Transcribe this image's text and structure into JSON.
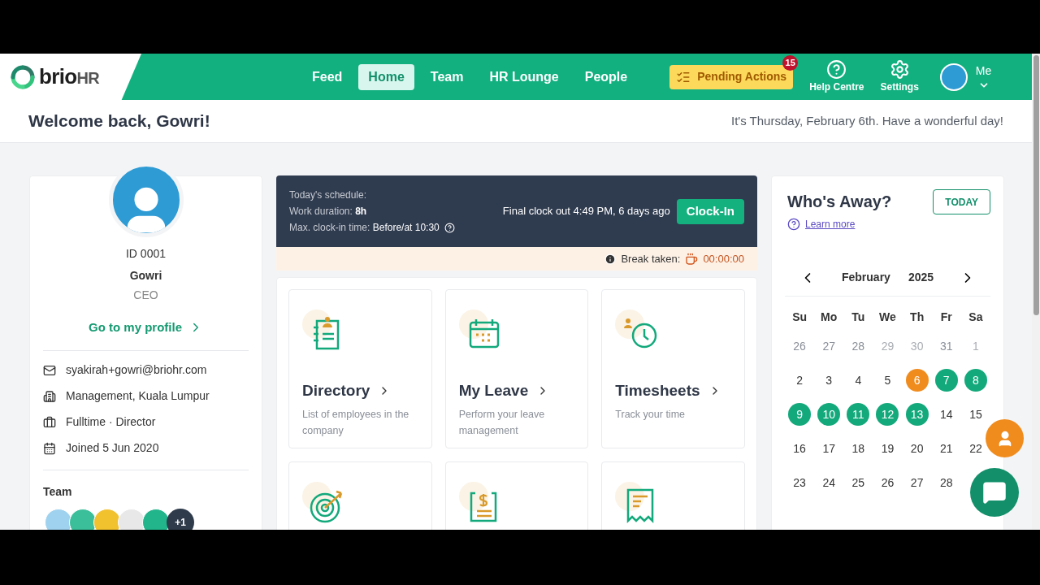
{
  "header": {
    "logo": {
      "brand": "brio",
      "suffix": "HR"
    },
    "nav": [
      {
        "label": "Feed",
        "selected": false
      },
      {
        "label": "Home",
        "selected": true
      },
      {
        "label": "Team",
        "selected": false
      },
      {
        "label": "HR Lounge",
        "selected": false
      },
      {
        "label": "People",
        "selected": false
      }
    ],
    "pending": {
      "label": "Pending Actions",
      "badge": "15"
    },
    "help": "Help Centre",
    "settings": "Settings",
    "me": "Me"
  },
  "welcome": {
    "title": "Welcome back, Gowri!",
    "greeting": "It's Thursday, February 6th. Have a wonderful day!"
  },
  "profile": {
    "id": "ID 0001",
    "name": "Gowri",
    "role": "CEO",
    "link": "Go to my profile",
    "details": [
      {
        "kind": "email",
        "text": "syakirah+gowri@briohr.com"
      },
      {
        "kind": "office",
        "text": "Management, Kuala Lumpur"
      },
      {
        "kind": "job",
        "text": "Fulltime · Director"
      },
      {
        "kind": "joined",
        "text": "Joined 5 Jun 2020"
      }
    ],
    "team_title": "Team",
    "team_more": "+1"
  },
  "schedule": {
    "title": "Today's schedule:",
    "duration_label": "Work duration:",
    "duration": "8h",
    "max_label": "Max. clock-in time:",
    "max": "Before/at 10:30",
    "last": "Final clock out 4:49 PM, 6 days ago",
    "button": "Clock-In",
    "break_label": "Break taken:",
    "break_time": "00:00:00"
  },
  "tiles": [
    {
      "kind": "directory",
      "title": "Directory",
      "desc": "List of employees in the company"
    },
    {
      "kind": "leave",
      "title": "My Leave",
      "desc": "Perform your leave management"
    },
    {
      "kind": "timesheets",
      "title": "Timesheets",
      "desc": "Track your time"
    },
    {
      "kind": "target"
    },
    {
      "kind": "payslip"
    },
    {
      "kind": "receipt"
    }
  ],
  "away": {
    "title": "Who's Away?",
    "today": "TODAY",
    "learn": "Learn more",
    "month": "February",
    "year": "2025",
    "weekdays": [
      "Su",
      "Mo",
      "Tu",
      "We",
      "Th",
      "Fr",
      "Sa"
    ],
    "days": [
      {
        "d": "26",
        "kind": "adjacent"
      },
      {
        "d": "27",
        "kind": "adjacent"
      },
      {
        "d": "28",
        "kind": "adjacent"
      },
      {
        "d": "29",
        "kind": "faint"
      },
      {
        "d": "30",
        "kind": "faint"
      },
      {
        "d": "31",
        "kind": "adjacent"
      },
      {
        "d": "1",
        "kind": "faint"
      },
      {
        "d": "2",
        "kind": "normal"
      },
      {
        "d": "3",
        "kind": "normal"
      },
      {
        "d": "4",
        "kind": "normal"
      },
      {
        "d": "5",
        "kind": "normal"
      },
      {
        "d": "6",
        "kind": "normal",
        "color": "#f08c1e"
      },
      {
        "d": "7",
        "kind": "normal",
        "color": "#13a97b"
      },
      {
        "d": "8",
        "kind": "normal",
        "color": "#13a97b"
      },
      {
        "d": "9",
        "kind": "normal",
        "color": "#13a97b"
      },
      {
        "d": "10",
        "kind": "normal",
        "color": "#13a97b"
      },
      {
        "d": "11",
        "kind": "normal",
        "color": "#13a97b"
      },
      {
        "d": "12",
        "kind": "normal",
        "color": "#13a97b"
      },
      {
        "d": "13",
        "kind": "normal",
        "color": "#13a97b"
      },
      {
        "d": "14",
        "kind": "normal"
      },
      {
        "d": "15",
        "kind": "normal"
      },
      {
        "d": "16",
        "kind": "normal"
      },
      {
        "d": "17",
        "kind": "normal"
      },
      {
        "d": "18",
        "kind": "normal"
      },
      {
        "d": "19",
        "kind": "normal"
      },
      {
        "d": "20",
        "kind": "normal"
      },
      {
        "d": "21",
        "kind": "normal"
      },
      {
        "d": "22",
        "kind": "normal"
      },
      {
        "d": "23",
        "kind": "normal"
      },
      {
        "d": "24",
        "kind": "normal"
      },
      {
        "d": "25",
        "kind": "normal"
      },
      {
        "d": "26",
        "kind": "normal"
      },
      {
        "d": "27",
        "kind": "normal"
      },
      {
        "d": "28",
        "kind": "normal"
      }
    ]
  }
}
